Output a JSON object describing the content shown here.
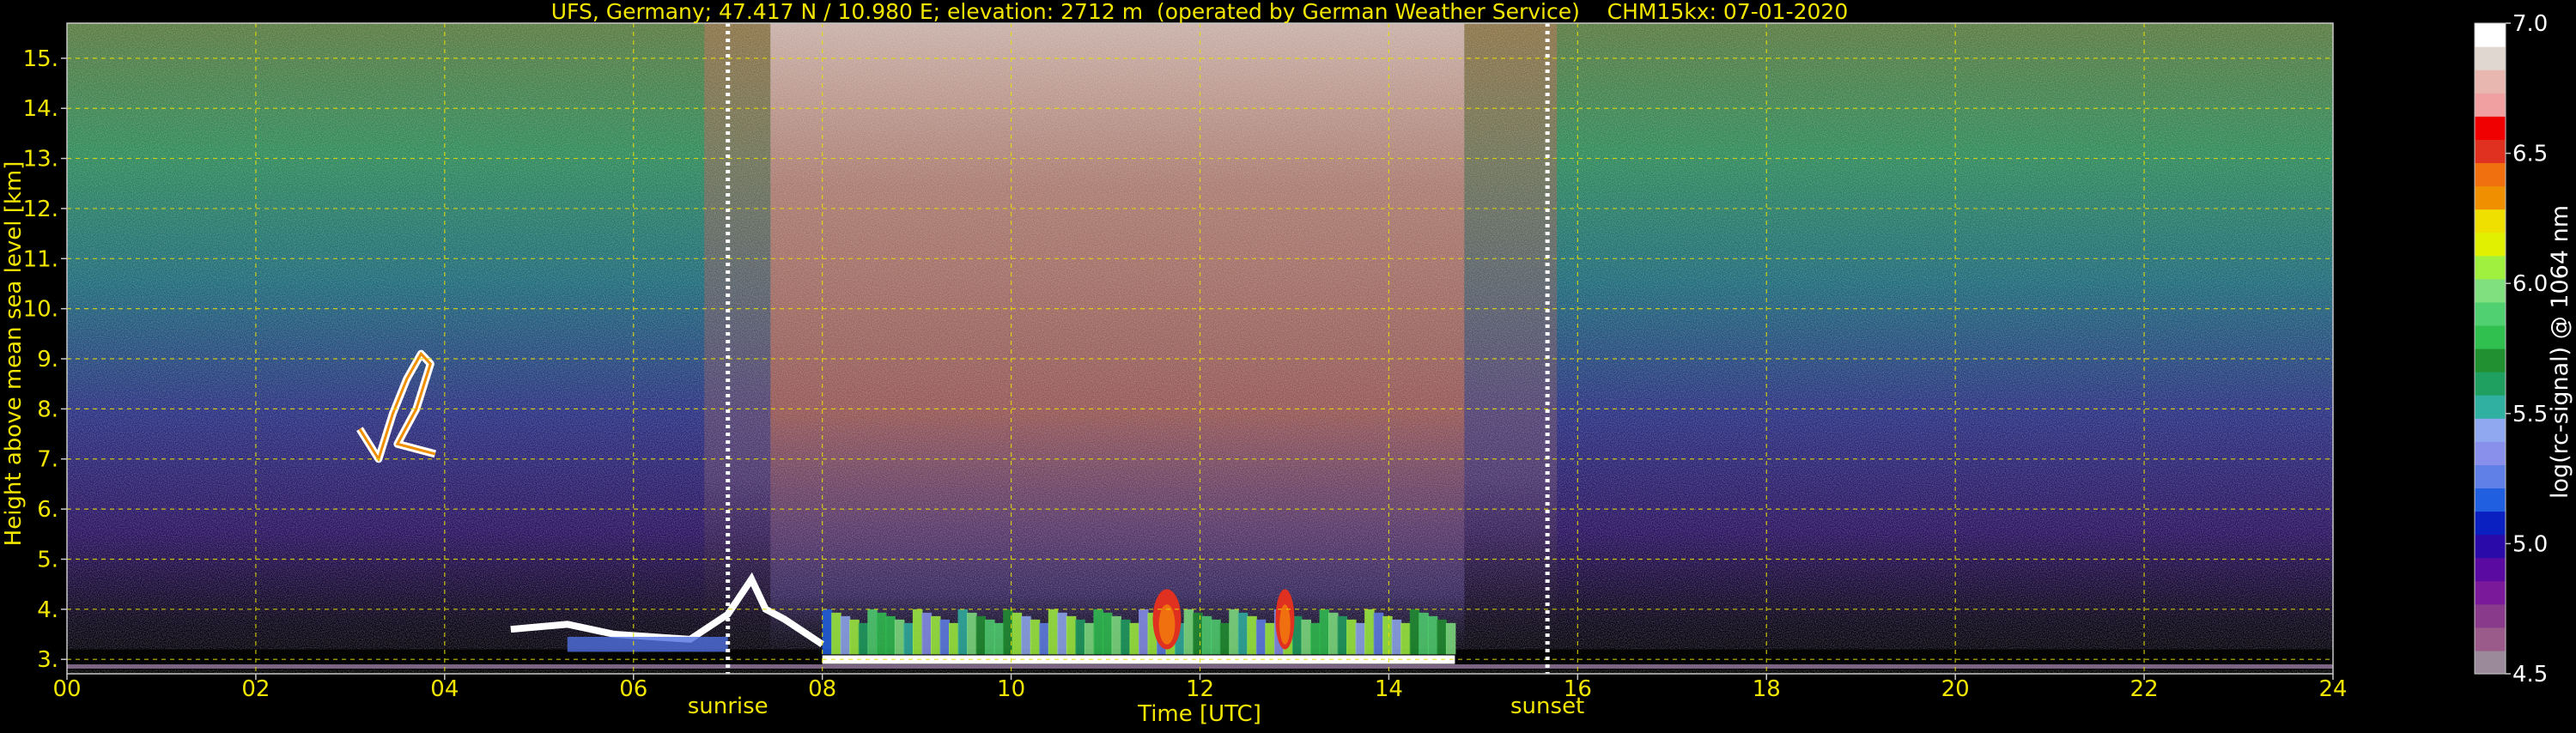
{
  "chart_data": {
    "type": "heatmap",
    "title": "UFS, Germany; 47.417 N / 10.980 E; elevation: 2712 m  (operated by German Weather Service)    CHM15kx: 07-01-2020",
    "xlabel": "Time [UTC]",
    "ylabel": "Height above mean sea level [km]",
    "xlim": [
      0,
      24
    ],
    "ylim": [
      2.712,
      15.7
    ],
    "x_ticks": [
      0,
      2,
      4,
      6,
      8,
      10,
      12,
      14,
      16,
      18,
      20,
      22,
      24
    ],
    "x_tick_labels": [
      "00",
      "02",
      "04",
      "06",
      "08",
      "10",
      "12",
      "14",
      "16",
      "18",
      "20",
      "22",
      "24"
    ],
    "y_ticks": [
      3,
      4,
      5,
      6,
      7,
      8,
      9,
      10,
      11,
      12,
      13,
      14,
      15
    ],
    "y_tick_labels": [
      "3.",
      "4.",
      "5.",
      "6.",
      "7.",
      "8.",
      "9.",
      "10.",
      "11.",
      "12.",
      "13.",
      "14.",
      "15."
    ],
    "grid": true,
    "events": [
      {
        "label": "sunrise",
        "time": 7.0
      },
      {
        "label": "sunset",
        "time": 15.68
      }
    ],
    "colorbar": {
      "label": "log(rc-signal) @ 1064 nm",
      "min": 4.5,
      "max": 7.0,
      "tick_values": [
        4.5,
        5.0,
        5.5,
        6.0,
        6.5,
        7.0
      ],
      "tick_labels": [
        "4.5",
        "5.0",
        "5.5",
        "6.0",
        "6.5",
        "7.0"
      ],
      "colors": [
        "#9a8a9a",
        "#9a5a8a",
        "#8a3a8a",
        "#7a1a9a",
        "#5a0aa0",
        "#2a0aa8",
        "#0a20c0",
        "#2060e0",
        "#6080e8",
        "#8890ec",
        "#90a8f0",
        "#30b0a0",
        "#20a060",
        "#209030",
        "#30c050",
        "#50d070",
        "#80e080",
        "#a0f040",
        "#e0f000",
        "#f0e000",
        "#f09000",
        "#f07010",
        "#e03020",
        "#f00000",
        "#f0a0a0",
        "#e8b8b0",
        "#e0d8d0",
        "#ffffff"
      ]
    },
    "features": [
      {
        "name": "cirrus layer",
        "time_range": [
          3.1,
          3.9
        ],
        "height_range": [
          6.7,
          9.2
        ],
        "level": 6.9
      },
      {
        "name": "boundary layer aerosol",
        "time_range": [
          8.0,
          14.7
        ],
        "height_range": [
          3.1,
          4.0
        ],
        "level": 5.8
      },
      {
        "name": "convective cell",
        "time_range": [
          11.5,
          11.8
        ],
        "height_range": [
          3.2,
          4.4
        ],
        "level": 6.5
      },
      {
        "name": "convective cell",
        "time_range": [
          12.8,
          13.0
        ],
        "height_range": [
          3.2,
          4.4
        ],
        "level": 6.5
      },
      {
        "name": "low cloud edge",
        "time_range": [
          4.7,
          7.6
        ],
        "height_range": [
          3.3,
          4.7
        ],
        "level": 7.0
      }
    ]
  }
}
